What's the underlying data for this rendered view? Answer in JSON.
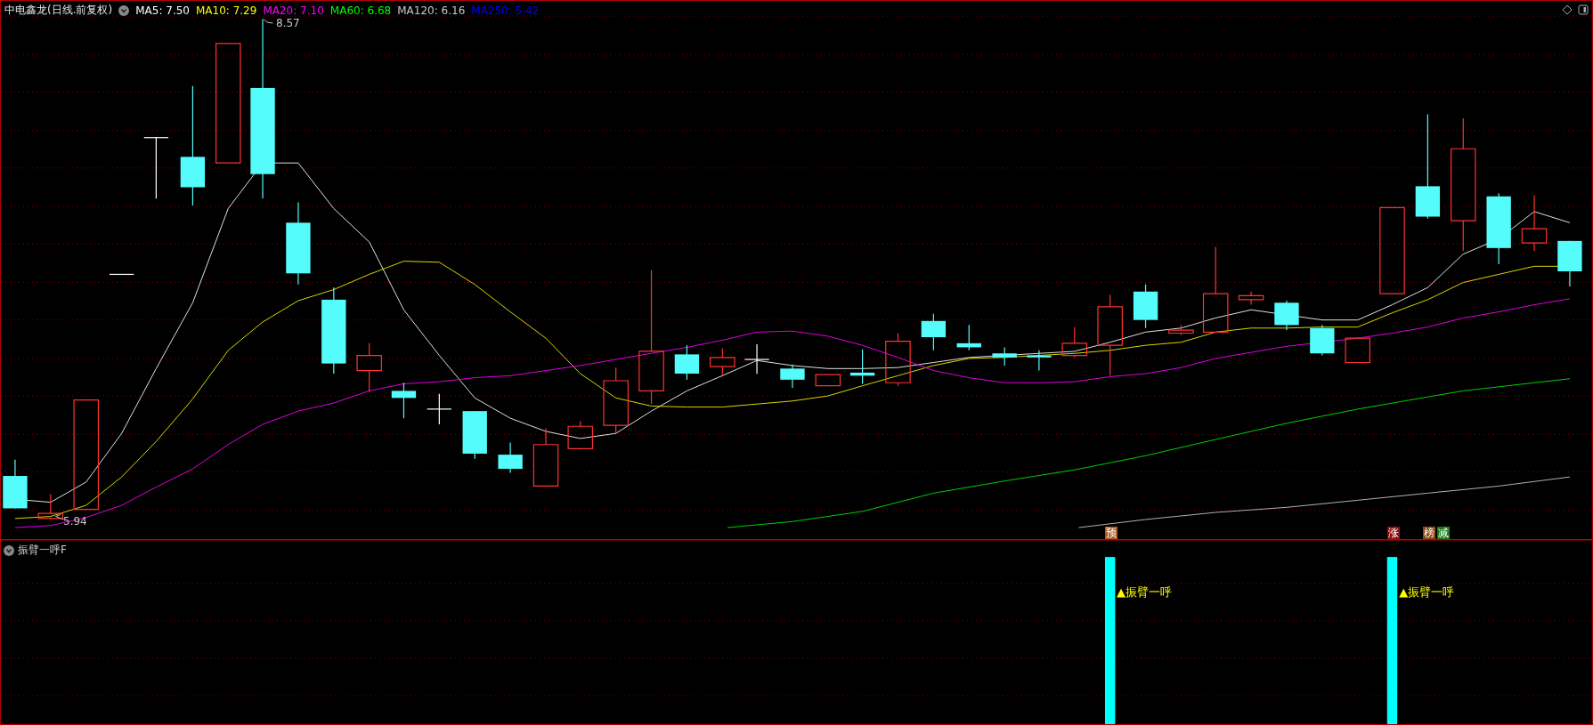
{
  "chart_title": "中电鑫龙(日线.前复权)",
  "ma_legend": [
    {
      "label": "MA5: 7.50",
      "color": "#ffffff"
    },
    {
      "label": "MA10: 7.29",
      "color": "#ffff00"
    },
    {
      "label": "MA20: 7.10",
      "color": "#ff00ff"
    },
    {
      "label": "MA60: 6.68",
      "color": "#00ff00"
    },
    {
      "label": "MA120: 6.16",
      "color": "#c8c8c8"
    },
    {
      "label": "MA250: 5.42",
      "color": "#0000ff"
    }
  ],
  "high_label": "8.57",
  "low_label": "5.94",
  "markers": [
    {
      "text": "预",
      "color": "#b4581e"
    },
    {
      "text": "涨",
      "color": "#8c1010"
    },
    {
      "text": "榜",
      "color": "#8c4a10"
    },
    {
      "text": "减",
      "color": "#1e7a1e"
    }
  ],
  "indicator": {
    "name": "振臂一呼F",
    "signals": [
      {
        "text": "▲振臂一呼"
      },
      {
        "text": "▲振臂一呼"
      }
    ]
  }
}
